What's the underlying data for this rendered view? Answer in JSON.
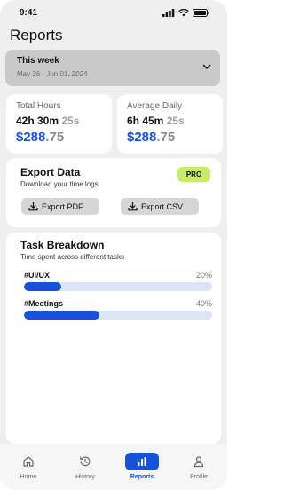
{
  "status_bar": {
    "time": "9:41"
  },
  "page": {
    "title": "Reports"
  },
  "date_range": {
    "title": "This week",
    "subtitle": "May 26 - Jun 01, 2024"
  },
  "stats": [
    {
      "label": "Total Hours",
      "time_main": "42h 30m",
      "time_muted": "25s",
      "money_main": "$288",
      "money_cents": ".75"
    },
    {
      "label": "Average Daily",
      "time_main": "6h 45m",
      "time_muted": "25s",
      "money_main": "$288",
      "money_cents": ".75"
    }
  ],
  "export": {
    "title": "Export Data",
    "subtitle": "Download your time logs",
    "badge": "PRO",
    "pdf_label": "Export PDF",
    "csv_label": "Export CSV"
  },
  "breakdown": {
    "title": "Task Breakdown",
    "subtitle": "Time spent across different tasks",
    "tasks": [
      {
        "name": "#UI/UX",
        "percent_label": "20%",
        "percent": 20
      },
      {
        "name": "#Meetings",
        "percent_label": "40%",
        "percent": 40
      }
    ]
  },
  "tabs": [
    {
      "label": "Home",
      "icon": "home-icon",
      "active": false
    },
    {
      "label": "History",
      "icon": "history-icon",
      "active": false
    },
    {
      "label": "Reports",
      "icon": "bar-chart-icon",
      "active": true
    },
    {
      "label": "Profile",
      "icon": "user-icon",
      "active": false
    }
  ],
  "colors": {
    "accent": "#1752d8",
    "pro_badge": "#c7ec6a",
    "money": "#1a52d6"
  }
}
